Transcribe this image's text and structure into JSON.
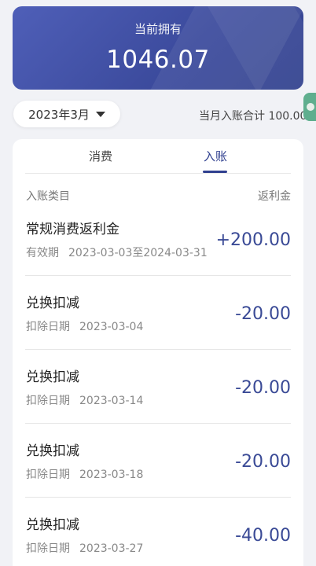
{
  "balance": {
    "label": "当前拥有",
    "amount": "1046.07"
  },
  "month_picker": {
    "value": "2023年3月"
  },
  "month_total": "当月入账合计 100.00",
  "tabs": [
    {
      "label": "消费",
      "active": false
    },
    {
      "label": "入账",
      "active": true
    }
  ],
  "list_header": {
    "left": "入账类目",
    "right": "返利金"
  },
  "entries": [
    {
      "title": "常规消费返利金",
      "meta_label": "有效期",
      "meta_value": "2023-03-03至2024-03-31",
      "amount": "+200.00"
    },
    {
      "title": "兑换扣减",
      "meta_label": "扣除日期",
      "meta_value": "2023-03-04",
      "amount": "-20.00"
    },
    {
      "title": "兑换扣减",
      "meta_label": "扣除日期",
      "meta_value": "2023-03-14",
      "amount": "-20.00"
    },
    {
      "title": "兑换扣减",
      "meta_label": "扣除日期",
      "meta_value": "2023-03-18",
      "amount": "-20.00"
    },
    {
      "title": "兑换扣减",
      "meta_label": "扣除日期",
      "meta_value": "2023-03-27",
      "amount": "-40.00"
    }
  ],
  "colors": {
    "primary": "#3b4a9c",
    "accent_text": "#2f3f8f",
    "float_button": "#5fae8e"
  }
}
